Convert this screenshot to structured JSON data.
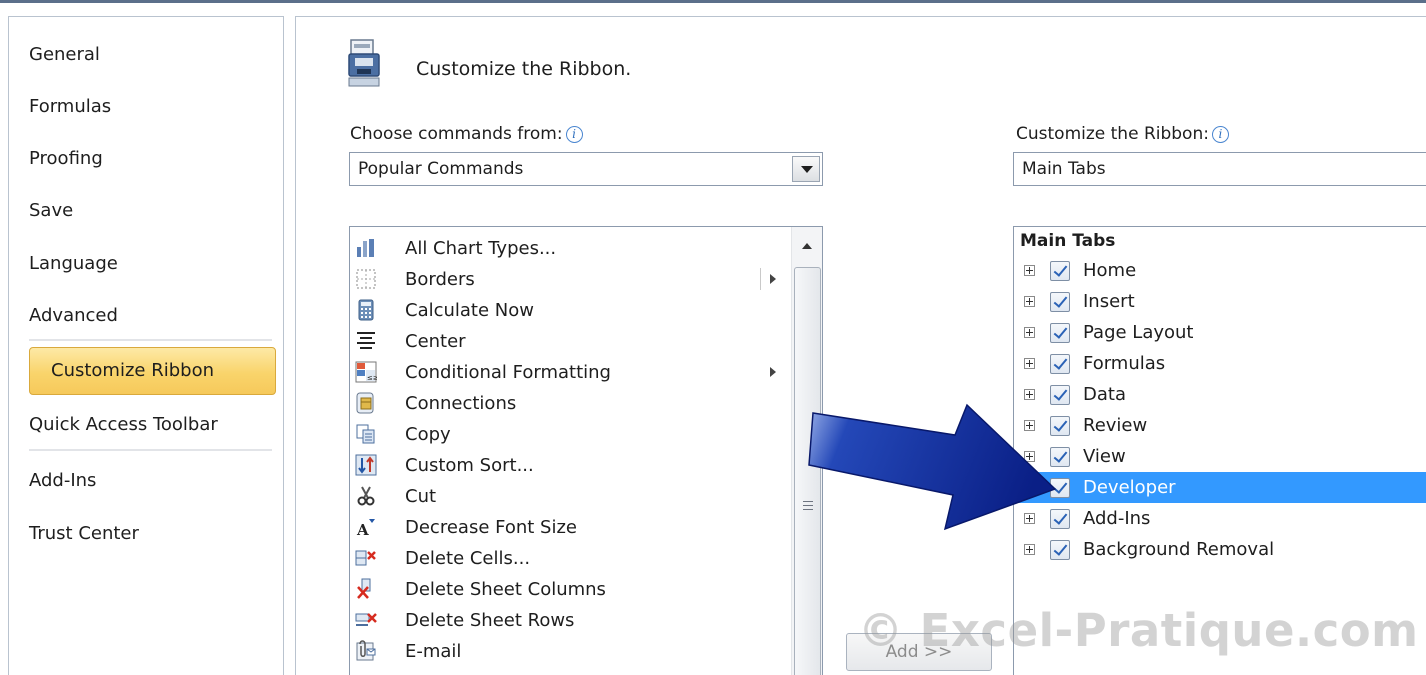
{
  "sidebar": {
    "items": [
      {
        "label": "General"
      },
      {
        "label": "Formulas"
      },
      {
        "label": "Proofing"
      },
      {
        "label": "Save"
      },
      {
        "label": "Language"
      },
      {
        "label": "Advanced"
      },
      {
        "label": "Customize Ribbon",
        "selected": true
      },
      {
        "label": "Quick Access Toolbar"
      },
      {
        "label": "Add-Ins"
      },
      {
        "label": "Trust Center"
      }
    ],
    "selected_color": "#f9d46b"
  },
  "header": {
    "title": "Customize the Ribbon.",
    "icon": "customize-ribbon-icon"
  },
  "commands": {
    "label": "Choose commands from:",
    "selected": "Popular Commands",
    "items": [
      {
        "label": "All Chart Types...",
        "icon": "chart-icon"
      },
      {
        "label": "Borders",
        "icon": "borders-icon",
        "submenu": true
      },
      {
        "label": "Calculate Now",
        "icon": "calculator-icon"
      },
      {
        "label": "Center",
        "icon": "align-center-icon"
      },
      {
        "label": "Conditional Formatting",
        "icon": "conditional-formatting-icon",
        "submenu": true
      },
      {
        "label": "Connections",
        "icon": "connections-icon"
      },
      {
        "label": "Copy",
        "icon": "copy-icon"
      },
      {
        "label": "Custom Sort...",
        "icon": "sort-icon"
      },
      {
        "label": "Cut",
        "icon": "scissors-icon"
      },
      {
        "label": "Decrease Font Size",
        "icon": "decrease-font-icon"
      },
      {
        "label": "Delete Cells...",
        "icon": "delete-cells-icon"
      },
      {
        "label": "Delete Sheet Columns",
        "icon": "delete-columns-icon"
      },
      {
        "label": "Delete Sheet Rows",
        "icon": "delete-rows-icon"
      },
      {
        "label": "E-mail",
        "icon": "email-icon"
      }
    ]
  },
  "add_button": {
    "label": "Add >>"
  },
  "ribbon": {
    "label": "Customize the Ribbon:",
    "selected": "Main Tabs",
    "tree_header": "Main Tabs",
    "tabs": [
      {
        "label": "Home",
        "checked": true
      },
      {
        "label": "Insert",
        "checked": true
      },
      {
        "label": "Page Layout",
        "checked": true
      },
      {
        "label": "Formulas",
        "checked": true
      },
      {
        "label": "Data",
        "checked": true
      },
      {
        "label": "Review",
        "checked": true
      },
      {
        "label": "View",
        "checked": true
      },
      {
        "label": "Developer",
        "checked": true,
        "selected": true
      },
      {
        "label": "Add-Ins",
        "checked": true
      },
      {
        "label": "Background Removal",
        "checked": true
      }
    ],
    "selected_color": "#3399ff"
  },
  "watermark": {
    "text": "© Excel-Pratique.com"
  }
}
